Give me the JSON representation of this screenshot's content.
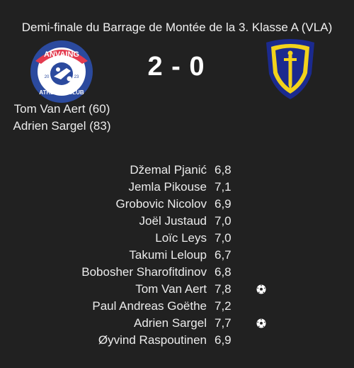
{
  "match": {
    "title": "Demi-finale du Barrage de Montée de la 3. Klasse A (VLA)",
    "score": "2 - 0"
  },
  "home_crest": {
    "icon": "anvaing-athletic-club-crest-icon",
    "top_text": "ANVAING",
    "bottom_text": "ATHLETIC CLUB",
    "year_left": "20",
    "year_right": "23",
    "colors": {
      "ring": "#2b4a9e",
      "banner": "#e33b4f",
      "inner": "#ffffff"
    }
  },
  "away_crest": {
    "icon": "shield-sword-crest-icon",
    "colors": {
      "outer": "#f2d21b",
      "inner": "#1b2a8f",
      "sword": "#f2d21b"
    }
  },
  "scorers": [
    {
      "text": "Tom Van Aert (60)"
    },
    {
      "text": "Adrien Sargel (83)"
    }
  ],
  "ratings": [
    {
      "name": "Džemal Pjanić",
      "rating": "6,8",
      "scored": false
    },
    {
      "name": "Jemla Pikouse",
      "rating": "7,1",
      "scored": false
    },
    {
      "name": "Grobovic Nicolov",
      "rating": "6,9",
      "scored": false
    },
    {
      "name": "Joël Justaud",
      "rating": "7,0",
      "scored": false
    },
    {
      "name": "Loïc Leys",
      "rating": "7,0",
      "scored": false
    },
    {
      "name": "Takumi Leloup",
      "rating": "6,7",
      "scored": false
    },
    {
      "name": "Bobosher Sharofitdinov",
      "rating": "6,8",
      "scored": false
    },
    {
      "name": "Tom Van Aert",
      "rating": "7,8",
      "scored": true
    },
    {
      "name": "Paul Andreas Goëthe",
      "rating": "7,2",
      "scored": false
    },
    {
      "name": "Adrien Sargel",
      "rating": "7,7",
      "scored": true
    },
    {
      "name": "Øyvind Raspoutinen",
      "rating": "6,9",
      "scored": false
    }
  ],
  "goal_icon": "soccer-ball-icon"
}
